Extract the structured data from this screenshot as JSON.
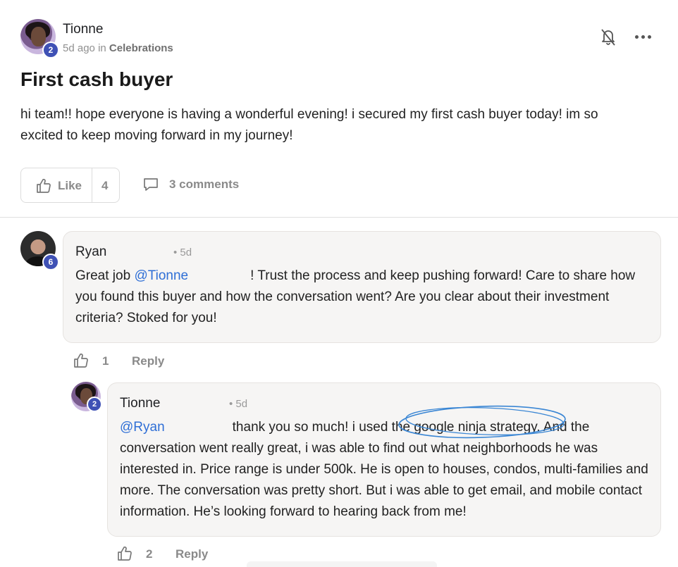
{
  "post": {
    "author": "Tionne",
    "level": "2",
    "time_ago": "5d ago",
    "in_word": "in",
    "category": "Celebrations",
    "title": "First cash buyer",
    "body": "hi team!! hope everyone is having a wonderful evening! i secured my first cash buyer today! im so excited to keep moving forward in my journey!",
    "like_label": "Like",
    "like_count": "4",
    "comments_label": "3 comments"
  },
  "comments": [
    {
      "author": "Ryan",
      "level": "6",
      "time": "• 5d",
      "mention": "@Tionne",
      "text_line1": "! Trust the process and keep pushing forward! Care to share",
      "text_prefix": "Great job",
      "text_rest": "how you found this buyer and how the conversation went? Are you clear about their investment criteria? Stoked for you!",
      "like_count": "1",
      "reply_label": "Reply"
    },
    {
      "author": "Tionne",
      "level": "2",
      "time": "• 5d",
      "mention": "@Ryan",
      "text_line1": "thank you so much! i used the google ninja strategy. And the",
      "text_rest": "conversation went really great, i was able to find out what neighborhoods he was interested in. Price range is under 500k. He is open to houses, condos, multi-families and more. The conversation was pretty short. But i was able to get email, and mobile contact information. He’s looking forward to hearing back from me!",
      "like_count": "2",
      "reply_label": "Reply"
    }
  ],
  "colors": {
    "mention": "#2f6fd6",
    "badge": "#3f51b5",
    "bubble": "#f6f5f4",
    "scribble": "#3a86d4"
  },
  "icons": [
    "bell-off-icon",
    "more-horizontal-icon",
    "thumbs-up-icon",
    "comment-icon"
  ]
}
